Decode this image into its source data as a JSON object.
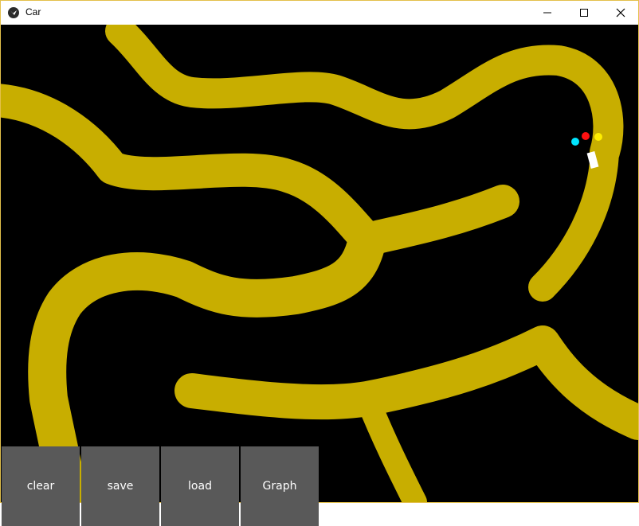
{
  "window": {
    "title": "Car",
    "controls": [
      "minimize-icon",
      "maximize-icon",
      "close-icon"
    ]
  },
  "buttons": {
    "clear": "clear",
    "save": "save",
    "load": "load",
    "graph": "Graph"
  },
  "colors": {
    "track": "#c8ae00",
    "background": "#000000",
    "button_bg": "#595959",
    "sensor_left": "#00e5ff",
    "sensor_center": "#ff1111",
    "sensor_right": "#ffee00",
    "car": "#ffffff"
  }
}
